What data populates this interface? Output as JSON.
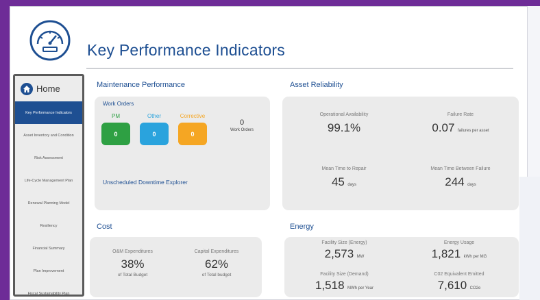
{
  "page": {
    "title": "Key Performance Indicators"
  },
  "sidebar": {
    "home_label": "Home",
    "items": [
      {
        "label": "Key Performance Indicators",
        "active": true
      },
      {
        "label": "Asset Inventory and Condition"
      },
      {
        "label": "Risk Assessment"
      },
      {
        "label": "Life-Cycle Management Plan"
      },
      {
        "label": "Renewal Planning Model"
      },
      {
        "label": "Resiliency"
      },
      {
        "label": "Financial Summary"
      },
      {
        "label": "Plan Improvement"
      },
      {
        "label": "Fiscal Sustainability Plan"
      }
    ]
  },
  "maintenance": {
    "section_title": "Maintenance Performance",
    "work_orders_title": "Work Orders",
    "pm": {
      "label": "PM",
      "value": "0",
      "color": "#2ea043"
    },
    "other": {
      "label": "Other",
      "value": "0",
      "color": "#2aa3dd"
    },
    "corrective": {
      "label": "Corrective",
      "value": "0",
      "color": "#f5a623"
    },
    "total": {
      "value": "0",
      "caption": "Work Orders"
    },
    "downtime_link": "Unscheduled Downtime Explorer"
  },
  "reliability": {
    "section_title": "Asset Reliability",
    "availability": {
      "label": "Operational Availability",
      "value": "99.1%"
    },
    "failure_rate": {
      "label": "Failure Rate",
      "value": "0.07",
      "unit": "failures per asset"
    },
    "mttr": {
      "label": "Mean Time to Repair",
      "value": "45",
      "unit": "days"
    },
    "mtbf": {
      "label": "Mean Time Between Failure",
      "value": "244",
      "unit": "days"
    }
  },
  "cost": {
    "section_title": "Cost",
    "om": {
      "label": "O&M Expenditures",
      "value": "38%",
      "sub": "of Total Budget"
    },
    "capital": {
      "label": "Capital Expenditures",
      "value": "62%",
      "sub": "of Total budget"
    }
  },
  "energy": {
    "section_title": "Energy",
    "facility_energy": {
      "label": "Facility Size (Energy)",
      "value": "2,573",
      "unit": "MW"
    },
    "usage": {
      "label": "Energy Usage",
      "value": "1,821",
      "unit": "kWh per MG"
    },
    "facility_demand": {
      "label": "Facility Size (Demand)",
      "value": "1,518",
      "unit": "MWh per Year"
    },
    "co2": {
      "label": "C02 Equivalent Emitted",
      "value": "7,610",
      "unit": "CO2e"
    }
  },
  "colors": {
    "accent": "#1e4f92",
    "frame": "#6e2c97"
  }
}
